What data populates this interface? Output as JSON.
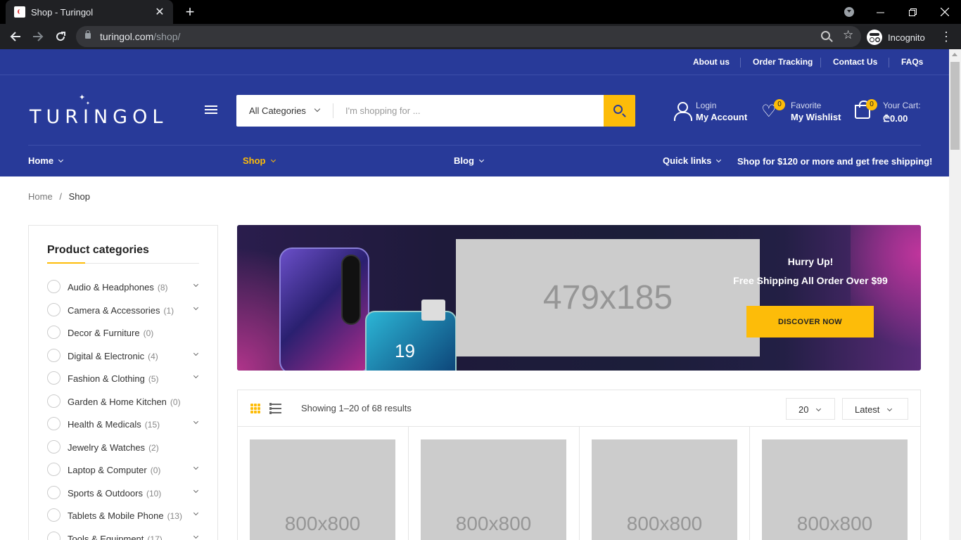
{
  "browser": {
    "tab_title": "Shop - Turingol",
    "url_host": "turingol.com",
    "url_path": "/shop/",
    "profile_label": "Incognito"
  },
  "topbar": {
    "links": [
      "About us",
      "Order Tracking",
      "Contact Us",
      "FAQs"
    ]
  },
  "header": {
    "logo_text": "TURINGOL",
    "search": {
      "category": "All Categories",
      "placeholder": "I'm shopping for ..."
    },
    "account": {
      "small": "Login",
      "big": "My Account"
    },
    "wishlist": {
      "small": "Favorite",
      "big": "My Wishlist",
      "count": "0"
    },
    "cart": {
      "small": "Your Cart:",
      "big": "₾0.00",
      "count": "0"
    }
  },
  "nav": {
    "items": [
      {
        "label": "Home",
        "active": false
      },
      {
        "label": "Shop",
        "active": true
      },
      {
        "label": "Blog",
        "active": false
      },
      {
        "label": "Quick links",
        "active": false
      }
    ],
    "promo": "Shop for $120 or more and get free shipping!"
  },
  "breadcrumb": {
    "home": "Home",
    "sep": "/",
    "current": "Shop"
  },
  "sidebar": {
    "title": "Product categories",
    "categories": [
      {
        "name": "Audio & Headphones",
        "count": "(8)",
        "expandable": true
      },
      {
        "name": "Camera & Accessories",
        "count": "(1)",
        "expandable": true
      },
      {
        "name": "Decor & Furniture",
        "count": "(0)",
        "expandable": false
      },
      {
        "name": "Digital & Electronic",
        "count": "(4)",
        "expandable": true
      },
      {
        "name": "Fashion & Clothing",
        "count": "(5)",
        "expandable": true
      },
      {
        "name": "Garden & Home Kitchen",
        "count": "(0)",
        "expandable": false
      },
      {
        "name": "Health & Medicals",
        "count": "(15)",
        "expandable": true
      },
      {
        "name": "Jewelry & Watches",
        "count": "(2)",
        "expandable": false
      },
      {
        "name": "Laptop & Computer",
        "count": "(0)",
        "expandable": true
      },
      {
        "name": "Sports & Outdoors",
        "count": "(10)",
        "expandable": true
      },
      {
        "name": "Tablets & Mobile Phone",
        "count": "(13)",
        "expandable": true
      },
      {
        "name": "Tools & Equipment",
        "count": "(17)",
        "expandable": true
      }
    ]
  },
  "banner": {
    "placeholder": "479x185",
    "phone_number": "19",
    "headline": "Hurry Up!",
    "subline": "Free Shipping All Order Over $99",
    "cta": "DISCOVER NOW"
  },
  "shop_toolbar": {
    "result_text": "Showing 1–20 of 68 results",
    "per_page": "20",
    "sort": "Latest"
  },
  "products": [
    {
      "placeholder": "800x800"
    },
    {
      "placeholder": "800x800"
    },
    {
      "placeholder": "800x800"
    },
    {
      "placeholder": "800x800"
    }
  ],
  "colors": {
    "brand_blue": "#283a99",
    "accent_yellow": "#fdbc09"
  }
}
